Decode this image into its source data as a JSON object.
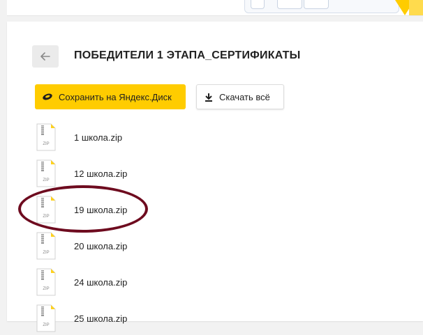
{
  "header": {
    "title": "ПОБЕДИТЕЛИ 1 ЭТАПА_СЕРТИФИКАТЫ"
  },
  "actions": {
    "save_label": "Сохранить на Яндекс.Диск",
    "download_label": "Скачать всё"
  },
  "files": [
    {
      "name": "1 школа.zip",
      "icon": "zip-file-icon"
    },
    {
      "name": "12 школа.zip",
      "icon": "zip-file-icon"
    },
    {
      "name": "19 школа.zip",
      "icon": "zip-file-icon",
      "highlighted": true
    },
    {
      "name": "20 школа.zip",
      "icon": "zip-file-icon"
    },
    {
      "name": "24 школа.zip",
      "icon": "zip-file-icon"
    },
    {
      "name": "25 школа.zip",
      "icon": "zip-file-icon"
    }
  ],
  "colors": {
    "accent": "#ffcc00",
    "annotation": "#6e0b1f",
    "background": "#f2f2f2"
  },
  "icons": {
    "back": "back-arrow-icon",
    "save": "yandex-disk-icon",
    "download": "download-icon"
  }
}
